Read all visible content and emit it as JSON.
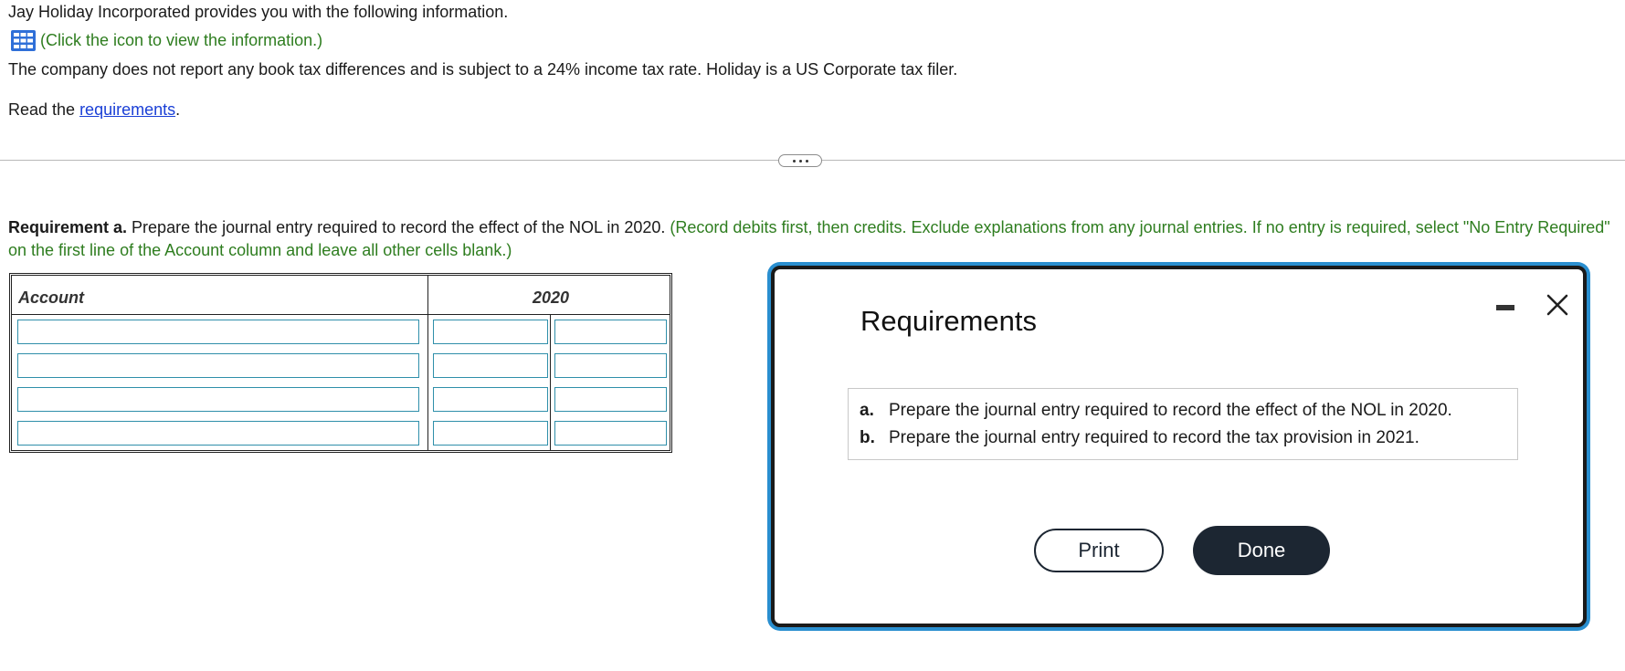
{
  "intro": {
    "line1": "Jay Holiday Incorporated provides you with the following information.",
    "info_link": "(Click the icon to view the information.)",
    "line3": "The company does not report any book tax differences and is subject to a 24% income tax rate. Holiday is a US Corporate tax filer.",
    "read_prefix": "Read the ",
    "read_link": "requirements",
    "read_suffix": "."
  },
  "requirement": {
    "label": "Requirement a.",
    "text": " Prepare the journal entry required to record the effect of the NOL in 2020. ",
    "instructions": "(Record debits first, then credits. Exclude explanations from any journal entries. If no entry is required, select \"No Entry Required\" on the first line of the Account column and leave all other cells blank.)"
  },
  "journal_table": {
    "col_account": "Account",
    "col_year": "2020",
    "rows": [
      {
        "account": "",
        "debit": "",
        "credit": ""
      },
      {
        "account": "",
        "debit": "",
        "credit": ""
      },
      {
        "account": "",
        "debit": "",
        "credit": ""
      },
      {
        "account": "",
        "debit": "",
        "credit": ""
      }
    ]
  },
  "modal": {
    "title": "Requirements",
    "items": [
      {
        "letter": "a.",
        "text": "Prepare the journal entry required to record the effect of the NOL in 2020."
      },
      {
        "letter": "b.",
        "text": "Prepare the journal entry required to record the tax provision in 2021."
      }
    ],
    "print_label": "Print",
    "done_label": "Done"
  },
  "icons": {
    "info": "grid-table-icon",
    "minimize": "minimize-icon",
    "close": "close-icon",
    "more": "ellipsis-icon"
  },
  "colors": {
    "green_text": "#2e7d1f",
    "link_blue": "#1a3fd6",
    "cell_border": "#2f8faa",
    "modal_outline": "#2a8fd0",
    "button_dark": "#1c2632"
  }
}
